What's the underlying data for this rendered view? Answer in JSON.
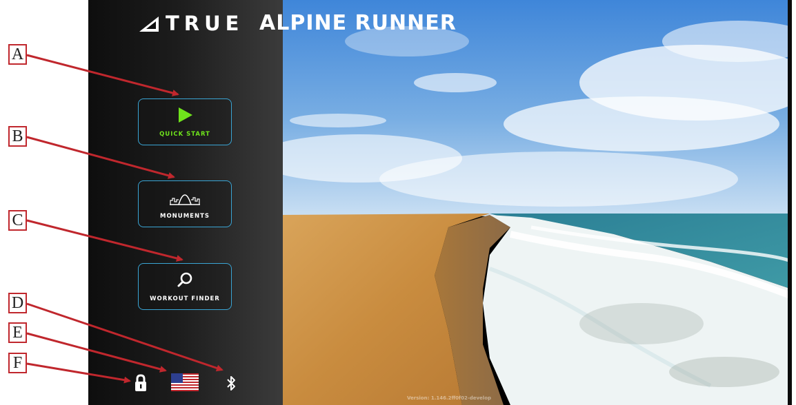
{
  "header": {
    "brand": "TRUE",
    "product": "ALPINE RUNNER"
  },
  "menu": [
    {
      "label": "QUICK START",
      "icon": "play-icon",
      "label_color": "#6fe31c"
    },
    {
      "label": "MONUMENTS",
      "icon": "monument-arch-icon",
      "label_color": "#ffffff"
    },
    {
      "label": "WORKOUT FINDER",
      "icon": "search-icon",
      "label_color": "#ffffff"
    }
  ],
  "bottom_icons": [
    {
      "icon": "lock-icon"
    },
    {
      "icon": "us-flag-icon"
    },
    {
      "icon": "bluetooth-icon"
    }
  ],
  "version_text": "Version: 1.146.2ff0f02-develop",
  "callouts": [
    "A",
    "B",
    "C",
    "D",
    "E",
    "F"
  ],
  "colors": {
    "button_border": "#3aa6d6",
    "quick_start_accent": "#6fe31c",
    "callout_red": "#c0272d"
  }
}
